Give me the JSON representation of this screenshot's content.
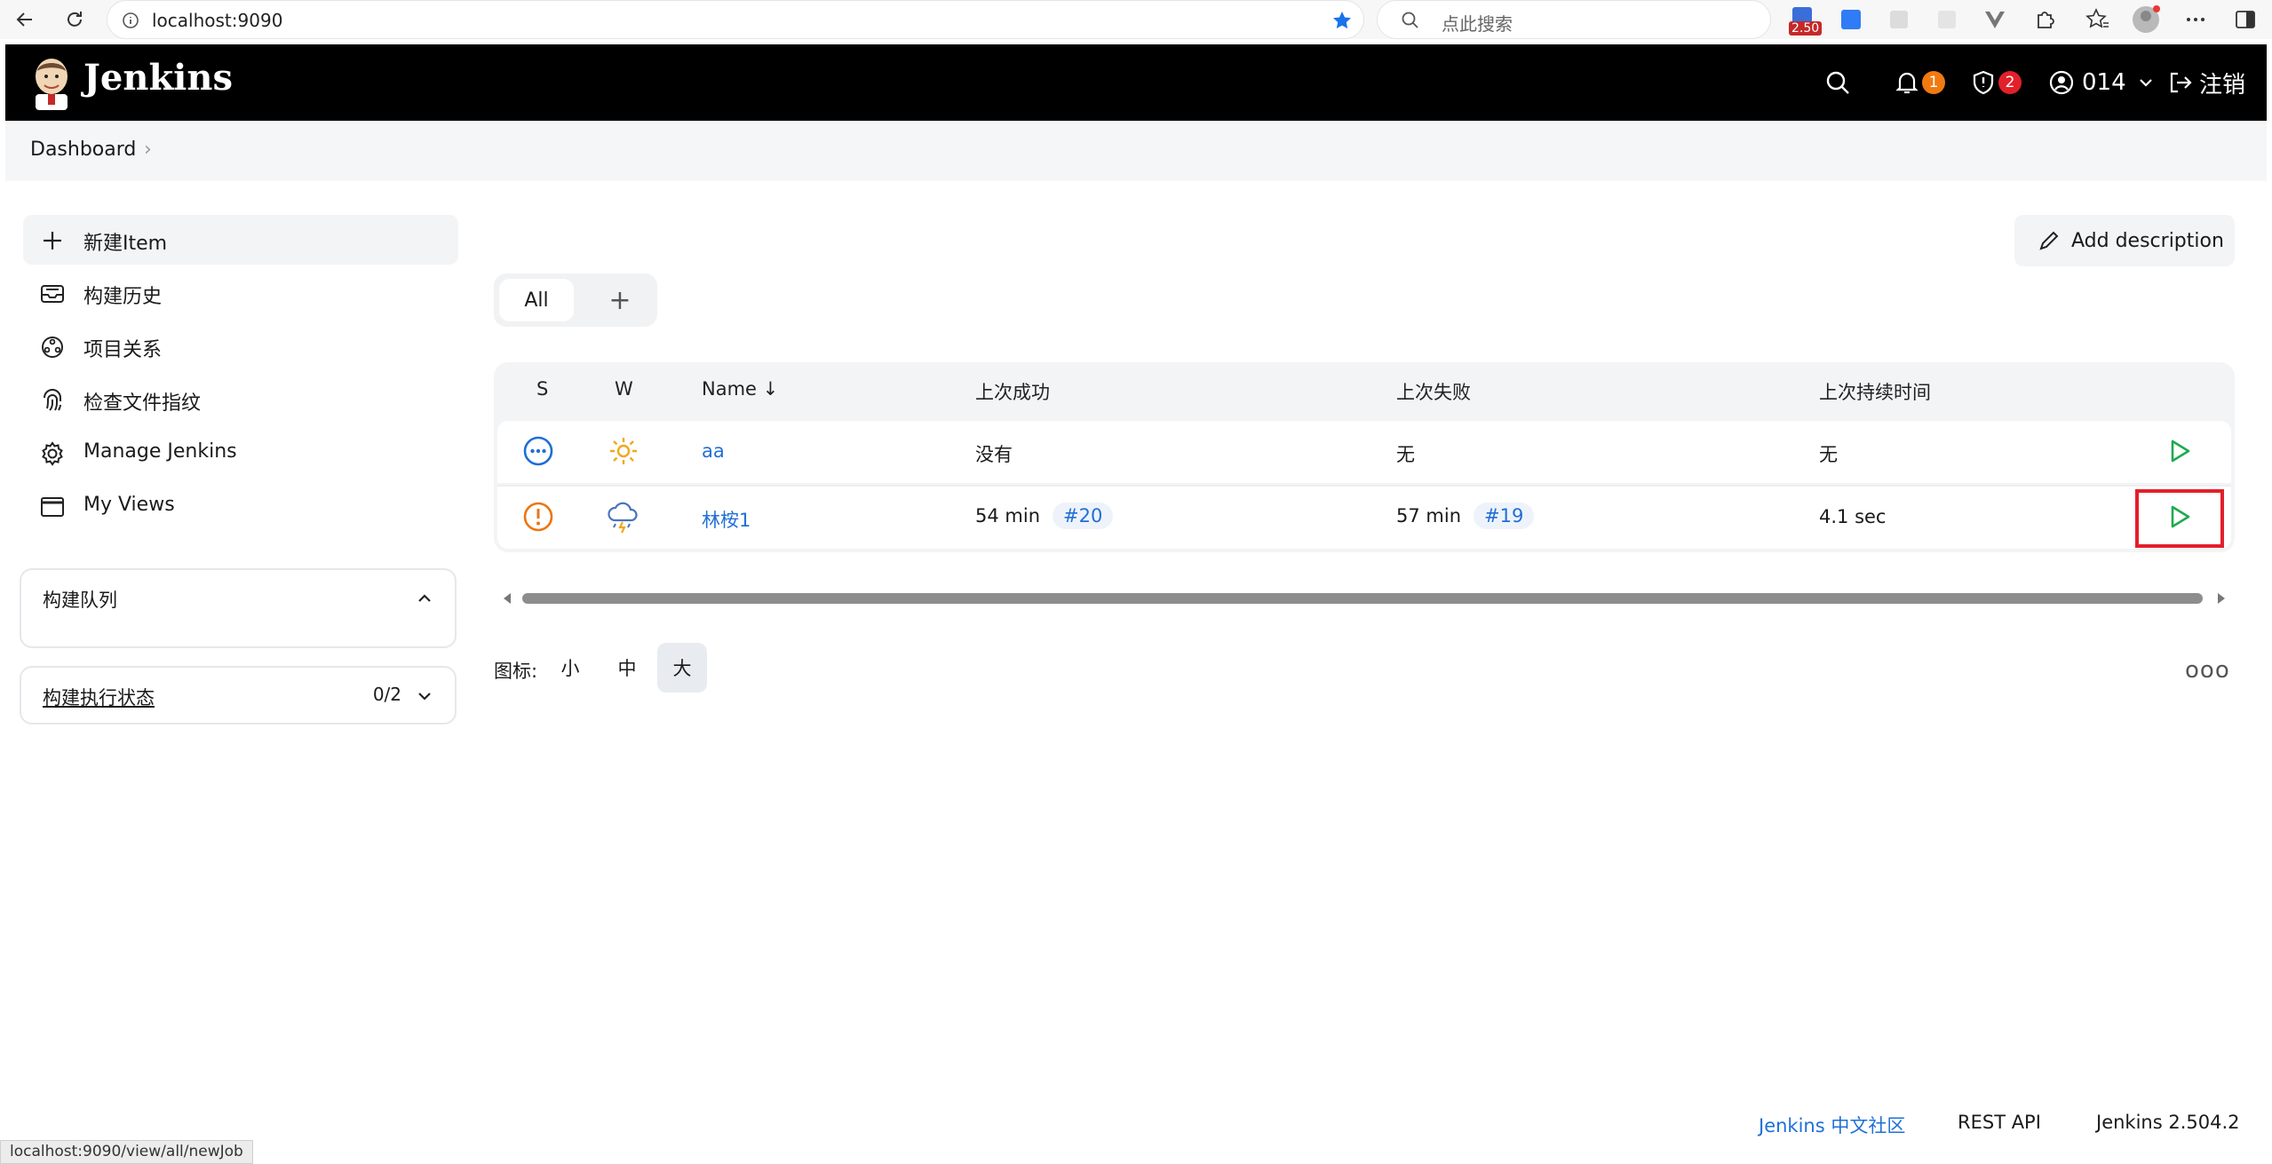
{
  "browser": {
    "url": "localhost:9090",
    "search_placeholder": "点此搜索",
    "ext_badge": "2.50"
  },
  "header": {
    "title": "Jenkins",
    "notifications_count": "1",
    "security_count": "2",
    "user": "014",
    "logout": "注销"
  },
  "breadcrumb": {
    "item": "Dashboard"
  },
  "sidebar": {
    "items": [
      {
        "label": "新建Item",
        "icon": "plus-icon"
      },
      {
        "label": "构建历史",
        "icon": "inbox-icon"
      },
      {
        "label": "项目关系",
        "icon": "relationship-icon"
      },
      {
        "label": "检查文件指纹",
        "icon": "fingerprint-icon"
      },
      {
        "label": "Manage Jenkins",
        "icon": "gear-icon"
      },
      {
        "label": "My Views",
        "icon": "window-icon"
      }
    ],
    "build_queue": "构建队列",
    "executor_status": "构建执行状态",
    "executor_count": "0/2"
  },
  "main": {
    "add_description": "Add description",
    "tabs": {
      "all": "All",
      "add": "+"
    },
    "table": {
      "headers": {
        "s": "S",
        "w": "W",
        "name": "Name ↓",
        "last_success": "上次成功",
        "last_failure": "上次失败",
        "last_duration": "上次持续时间"
      },
      "rows": [
        {
          "name": "aa",
          "status": "not-built",
          "weather": "sunny",
          "last_success": "没有",
          "last_success_build": "",
          "last_failure": "无",
          "last_failure_build": "",
          "last_duration": "无"
        },
        {
          "name": "林桉1",
          "status": "unstable",
          "weather": "thunderstorm",
          "last_success": "54 min",
          "last_success_build": "#20",
          "last_failure": "57 min",
          "last_failure_build": "#19",
          "last_duration": "4.1 sec"
        }
      ]
    },
    "icon_size": {
      "label": "图标:",
      "small": "小",
      "medium": "中",
      "large": "大",
      "selected": "大"
    },
    "more": "ooo"
  },
  "footer": {
    "community": "Jenkins 中文社区",
    "rest_api": "REST API",
    "version": "Jenkins 2.504.2"
  },
  "statusbar": "localhost:9090/view/all/newJob",
  "colors": {
    "header_bg": "#000000",
    "link": "#1f6fd6",
    "play": "#1eaa4f",
    "notif_badge": "#f07a10",
    "security_badge": "#e2202a",
    "highlight": "#e2202a"
  }
}
